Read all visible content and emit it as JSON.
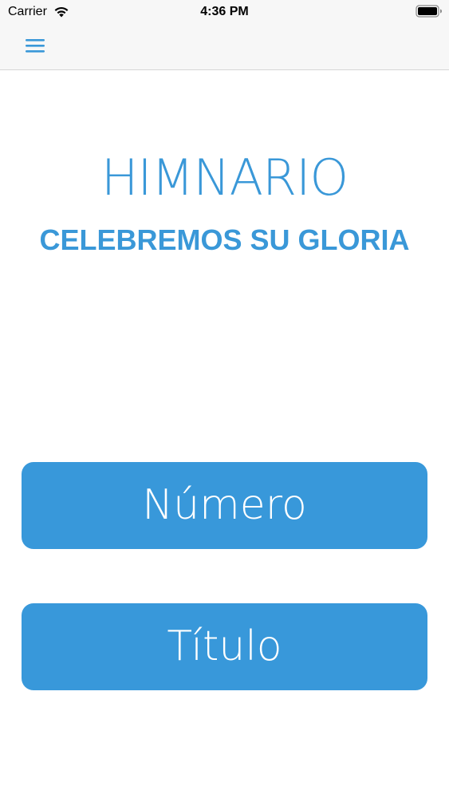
{
  "status_bar": {
    "carrier": "Carrier",
    "time": "4:36 PM",
    "wifi_icon": "wifi-icon",
    "battery_icon": "battery-icon"
  },
  "nav_bar": {
    "menu_icon": "hamburger-menu-icon",
    "accent_color": "#3a98d8",
    "background_color": "#f7f7f7"
  },
  "main": {
    "title": "HIMNARIO",
    "subtitle": "CELEBREMOS SU GLORIA",
    "text_color": "#3a98d8"
  },
  "buttons": {
    "numero_label": "Número",
    "titulo_label": "Título",
    "button_color": "#3898da",
    "label_color": "#ffffff"
  }
}
